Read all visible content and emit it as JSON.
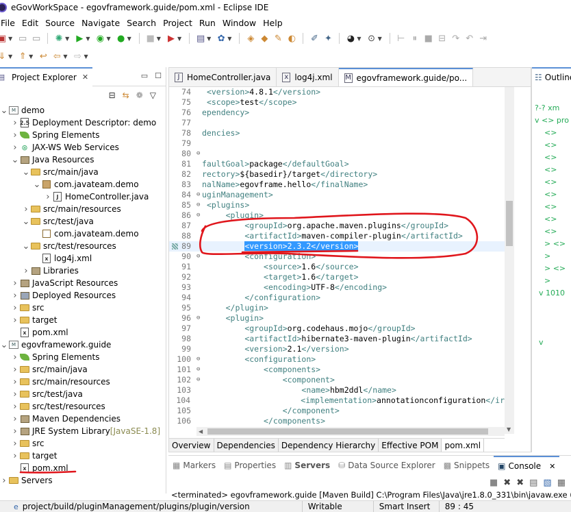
{
  "window": {
    "title": "eGovWorkSpace - egovframework.guide/pom.xml - Eclipse IDE"
  },
  "menu": [
    "File",
    "Edit",
    "Source",
    "Navigate",
    "Search",
    "Project",
    "Run",
    "Window",
    "Help"
  ],
  "project_explorer": {
    "title": "Project Explorer",
    "items": [
      {
        "label": "demo",
        "level": 0,
        "tw": "v",
        "icon": "project"
      },
      {
        "label": "Deployment Descriptor: demo",
        "level": 1,
        "tw": ">",
        "icon": "descriptor"
      },
      {
        "label": "Spring Elements",
        "level": 1,
        "tw": ">",
        "icon": "spring"
      },
      {
        "label": "JAX-WS Web Services",
        "level": 1,
        "tw": ">",
        "icon": "ws"
      },
      {
        "label": "Java Resources",
        "level": 1,
        "tw": "v",
        "icon": "java-res"
      },
      {
        "label": "src/main/java",
        "level": 2,
        "tw": "v",
        "icon": "src-folder"
      },
      {
        "label": "com.javateam.demo",
        "level": 3,
        "tw": "v",
        "icon": "package"
      },
      {
        "label": "HomeController.java",
        "level": 4,
        "tw": ">",
        "icon": "java-file"
      },
      {
        "label": "src/main/resources",
        "level": 2,
        "tw": ">",
        "icon": "src-folder"
      },
      {
        "label": "src/test/java",
        "level": 2,
        "tw": "v",
        "icon": "src-folder"
      },
      {
        "label": "com.javateam.demo",
        "level": 3,
        "tw": "",
        "icon": "package-empty"
      },
      {
        "label": "src/test/resources",
        "level": 2,
        "tw": "v",
        "icon": "src-folder"
      },
      {
        "label": "log4j.xml",
        "level": 3,
        "tw": "",
        "icon": "xml-file"
      },
      {
        "label": "Libraries",
        "level": 2,
        "tw": ">",
        "icon": "library"
      },
      {
        "label": "JavaScript Resources",
        "level": 1,
        "tw": ">",
        "icon": "js-res"
      },
      {
        "label": "Deployed Resources",
        "level": 1,
        "tw": ">",
        "icon": "deployed"
      },
      {
        "label": "src",
        "level": 1,
        "tw": ">",
        "icon": "folder"
      },
      {
        "label": "target",
        "level": 1,
        "tw": ">",
        "icon": "folder"
      },
      {
        "label": "pom.xml",
        "level": 1,
        "tw": "",
        "icon": "xml-file"
      },
      {
        "label": "egovframework.guide",
        "level": 0,
        "tw": "v",
        "icon": "project"
      },
      {
        "label": "Spring Elements",
        "level": 1,
        "tw": ">",
        "icon": "spring"
      },
      {
        "label": "src/main/java",
        "level": 1,
        "tw": ">",
        "icon": "src-folder"
      },
      {
        "label": "src/main/resources",
        "level": 1,
        "tw": ">",
        "icon": "src-folder"
      },
      {
        "label": "src/test/java",
        "level": 1,
        "tw": ">",
        "icon": "src-folder"
      },
      {
        "label": "src/test/resources",
        "level": 1,
        "tw": ">",
        "icon": "src-folder"
      },
      {
        "label": "Maven Dependencies",
        "level": 1,
        "tw": ">",
        "icon": "library"
      },
      {
        "label": "JRE System Library",
        "suffix": " [JavaSE-1.8]",
        "level": 1,
        "tw": ">",
        "icon": "library"
      },
      {
        "label": "src",
        "level": 1,
        "tw": ">",
        "icon": "folder"
      },
      {
        "label": "target",
        "level": 1,
        "tw": ">",
        "icon": "folder"
      },
      {
        "label": "pom.xml",
        "level": 1,
        "tw": "",
        "icon": "xml-file"
      },
      {
        "label": "Servers",
        "level": 0,
        "tw": ">",
        "icon": "folder"
      }
    ]
  },
  "editor": {
    "tabs": [
      {
        "label": "HomeController.java",
        "active": false
      },
      {
        "label": "log4j.xml",
        "active": false
      },
      {
        "label": "egovframework.guide/po...",
        "active": true
      }
    ],
    "lines": [
      {
        "n": "74",
        "f": "",
        "parts": [
          [
            "t",
            "<version>"
          ],
          [
            "v",
            "4.8.1"
          ],
          [
            "t",
            "</version>"
          ]
        ],
        "indent": " "
      },
      {
        "n": "75",
        "f": "",
        "parts": [
          [
            "t",
            "<scope>"
          ],
          [
            "v",
            "test"
          ],
          [
            "t",
            "</scope>"
          ]
        ],
        "indent": " "
      },
      {
        "n": "76",
        "f": "",
        "parts": [
          [
            "t",
            "ependency>"
          ]
        ],
        "indent": ""
      },
      {
        "n": "77",
        "f": "",
        "parts": [],
        "indent": ""
      },
      {
        "n": "78",
        "f": "",
        "parts": [
          [
            "t",
            "dencies>"
          ]
        ],
        "indent": ""
      },
      {
        "n": "79",
        "f": "",
        "parts": [],
        "indent": ""
      },
      {
        "n": "80",
        "f": "⊖",
        "parts": [],
        "indent": ""
      },
      {
        "n": "81",
        "f": "",
        "parts": [
          [
            "t",
            "faultGoal>"
          ],
          [
            "v",
            "package"
          ],
          [
            "t",
            "</defaultGoal>"
          ]
        ],
        "indent": ""
      },
      {
        "n": "82",
        "f": "",
        "parts": [
          [
            "t",
            "rectory>"
          ],
          [
            "v",
            "${basedir}/target"
          ],
          [
            "t",
            "</directory>"
          ]
        ],
        "indent": ""
      },
      {
        "n": "83",
        "f": "",
        "parts": [
          [
            "t",
            "nalName>"
          ],
          [
            "v",
            "egovframe.hello"
          ],
          [
            "t",
            "</finalName>"
          ]
        ],
        "indent": ""
      },
      {
        "n": "84",
        "f": "⊖",
        "parts": [
          [
            "t",
            "uginManagement>"
          ]
        ],
        "indent": ""
      },
      {
        "n": "85",
        "f": "⊖",
        "parts": [
          [
            "t",
            "<plugins>"
          ]
        ],
        "indent": " "
      },
      {
        "n": "86",
        "f": "⊖",
        "parts": [
          [
            "t",
            "<plugin>"
          ]
        ],
        "indent": "     "
      },
      {
        "n": "87",
        "f": "",
        "parts": [
          [
            "t",
            "<groupId>"
          ],
          [
            "v",
            "org.apache.maven.plugins"
          ],
          [
            "t",
            "</groupId>"
          ]
        ],
        "indent": "         "
      },
      {
        "n": "88",
        "f": "",
        "parts": [
          [
            "t",
            "<artifactId>"
          ],
          [
            "v",
            "maven-compiler-plugin"
          ],
          [
            "t",
            "</artifactId>"
          ]
        ],
        "indent": "         "
      },
      {
        "n": "89",
        "f": "",
        "parts": [
          [
            "s",
            "<version>2.3.2</version>"
          ]
        ],
        "indent": "         ",
        "hl": true
      },
      {
        "n": "90",
        "f": "⊖",
        "parts": [
          [
            "t",
            "<configuration>"
          ]
        ],
        "indent": "         "
      },
      {
        "n": "91",
        "f": "",
        "parts": [
          [
            "t",
            "<source>"
          ],
          [
            "v",
            "1.6"
          ],
          [
            "t",
            "</source>"
          ]
        ],
        "indent": "             "
      },
      {
        "n": "92",
        "f": "",
        "parts": [
          [
            "t",
            "<target>"
          ],
          [
            "v",
            "1.6"
          ],
          [
            "t",
            "</target>"
          ]
        ],
        "indent": "             "
      },
      {
        "n": "93",
        "f": "",
        "parts": [
          [
            "t",
            "<encoding>"
          ],
          [
            "v",
            "UTF-8"
          ],
          [
            "t",
            "</encoding>"
          ]
        ],
        "indent": "             "
      },
      {
        "n": "94",
        "f": "",
        "parts": [
          [
            "t",
            "</configuration>"
          ]
        ],
        "indent": "         "
      },
      {
        "n": "95",
        "f": "",
        "parts": [
          [
            "t",
            "</plugin>"
          ]
        ],
        "indent": "     "
      },
      {
        "n": "96",
        "f": "⊖",
        "parts": [
          [
            "t",
            "<plugin>"
          ]
        ],
        "indent": "     "
      },
      {
        "n": "97",
        "f": "",
        "parts": [
          [
            "t",
            "<groupId>"
          ],
          [
            "v",
            "org.codehaus.mojo"
          ],
          [
            "t",
            "</groupId>"
          ]
        ],
        "indent": "         "
      },
      {
        "n": "98",
        "f": "",
        "parts": [
          [
            "t",
            "<artifactId>"
          ],
          [
            "v",
            "hibernate3-maven-plugin"
          ],
          [
            "t",
            "</artifactId>"
          ]
        ],
        "indent": "         "
      },
      {
        "n": "99",
        "f": "",
        "parts": [
          [
            "t",
            "<version>"
          ],
          [
            "v",
            "2.1"
          ],
          [
            "t",
            "</version>"
          ]
        ],
        "indent": "         "
      },
      {
        "n": "100",
        "f": "⊖",
        "parts": [
          [
            "t",
            "<configuration>"
          ]
        ],
        "indent": "         "
      },
      {
        "n": "101",
        "f": "⊖",
        "parts": [
          [
            "t",
            "<components>"
          ]
        ],
        "indent": "             "
      },
      {
        "n": "102",
        "f": "⊖",
        "parts": [
          [
            "t",
            "<component>"
          ]
        ],
        "indent": "                 "
      },
      {
        "n": "103",
        "f": "",
        "parts": [
          [
            "t",
            "<name>"
          ],
          [
            "v",
            "hbm2ddl"
          ],
          [
            "t",
            "</name>"
          ]
        ],
        "indent": "                     "
      },
      {
        "n": "104",
        "f": "",
        "parts": [
          [
            "t",
            "<implementation>"
          ],
          [
            "v",
            "annotationconfiguration"
          ],
          [
            "t",
            "</ir"
          ]
        ],
        "indent": "                     "
      },
      {
        "n": "105",
        "f": "",
        "parts": [
          [
            "t",
            "</component>"
          ]
        ],
        "indent": "                 "
      },
      {
        "n": "106",
        "f": "",
        "parts": [
          [
            "t",
            "</components>"
          ]
        ],
        "indent": "             "
      }
    ],
    "bottom_tabs": [
      "Overview",
      "Dependencies",
      "Dependency Hierarchy",
      "Effective POM",
      "pom.xml"
    ],
    "active_bottom_tab": "pom.xml"
  },
  "outline": {
    "title": "Outline",
    "rows": [
      "?-? xm",
      "v <> pro",
      "<> ",
      "<> ",
      "<> ",
      "<> ",
      "<> ",
      "<> ",
      "<> ",
      "<> ",
      "<> ",
      "> <> ",
      "> ",
      "> <> ",
      "> ",
      "v 1010",
      "",
      "",
      "",
      "v",
      ""
    ]
  },
  "bottom_panel": {
    "tabs": [
      {
        "label": "Markers",
        "active": false,
        "bold": false
      },
      {
        "label": "Properties",
        "active": false,
        "bold": false
      },
      {
        "label": "Servers",
        "active": false,
        "bold": true
      },
      {
        "label": "Data Source Explorer",
        "active": false,
        "bold": false
      },
      {
        "label": "Snippets",
        "active": false,
        "bold": false
      },
      {
        "label": "Console",
        "active": true,
        "bold": false
      }
    ],
    "console_line": "<terminated> egovframework.guide [Maven Build] C:\\Program Files\\Java\\jre1.8.0_331\\bin\\javaw.exe (20"
  },
  "status": {
    "path": "project/build/pluginManagement/plugins/plugin/version",
    "mode": "Writable",
    "insert": "Smart Insert",
    "position": "89 : 45"
  },
  "colors": {
    "accent": "#5a8fd6",
    "annotation": "#e0161c",
    "selection": "#3399ff"
  }
}
